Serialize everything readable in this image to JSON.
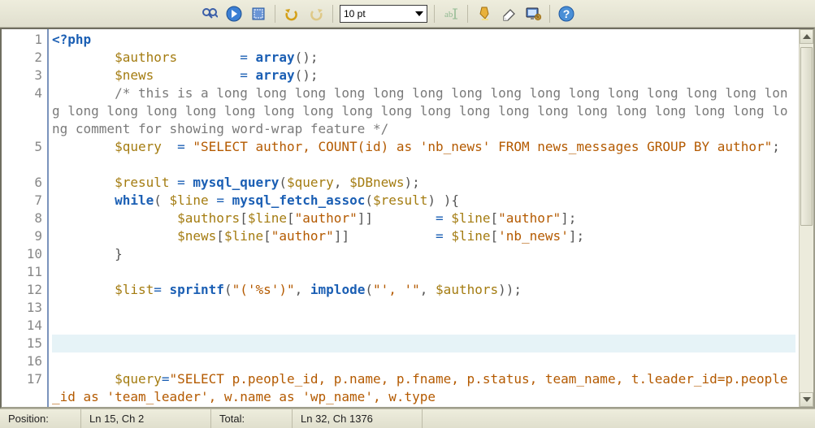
{
  "toolbar": {
    "font_size": "10 pt",
    "icons": {
      "find": "find-icon",
      "go": "go-icon",
      "rect": "rect-icon",
      "undo": "undo-icon",
      "redo": "redo-icon",
      "rename": "rename-icon",
      "highlight": "highlight-icon",
      "erase": "erase-icon",
      "display": "display-icon",
      "help": "help-icon"
    }
  },
  "gutter": {
    "lines": [
      "1",
      "2",
      "3",
      "4",
      "5",
      "6",
      "7",
      "8",
      "9",
      "10",
      "11",
      "12",
      "13",
      "14",
      "15",
      "16",
      "17"
    ],
    "heights": [
      1,
      1,
      1,
      3,
      2,
      1,
      1,
      1,
      1,
      1,
      1,
      1,
      1,
      1,
      1,
      1,
      2
    ]
  },
  "code": {
    "lines": [
      {
        "h": 1,
        "parts": [
          [
            "kw",
            "<?php"
          ]
        ]
      },
      {
        "h": 1,
        "parts": [
          [
            "plain",
            "        "
          ],
          [
            "var",
            "$authors"
          ],
          [
            "plain",
            "        "
          ],
          [
            "op",
            "= "
          ],
          [
            "fn",
            "array"
          ],
          [
            "plain",
            "();"
          ]
        ]
      },
      {
        "h": 1,
        "parts": [
          [
            "plain",
            "        "
          ],
          [
            "var",
            "$news"
          ],
          [
            "plain",
            "           "
          ],
          [
            "op",
            "= "
          ],
          [
            "fn",
            "array"
          ],
          [
            "plain",
            "();"
          ]
        ]
      },
      {
        "h": 3,
        "parts": [
          [
            "plain",
            "        "
          ],
          [
            "cmt",
            "/* this is a long long long long long long long long long long long long long long long long long long long long long long long long long long long long long long long long long long comment for showing word-wrap feature */"
          ]
        ]
      },
      {
        "h": 2,
        "parts": [
          [
            "plain",
            "        "
          ],
          [
            "var",
            "$query"
          ],
          [
            "plain",
            "  "
          ],
          [
            "op",
            "= "
          ],
          [
            "str",
            "\"SELECT author, COUNT(id) as 'nb_news' FROM news_messages GROUP BY author\""
          ],
          [
            "plain",
            ";"
          ]
        ]
      },
      {
        "h": 1,
        "parts": [
          [
            "plain",
            "        "
          ],
          [
            "var",
            "$result"
          ],
          [
            "plain",
            " "
          ],
          [
            "op",
            "= "
          ],
          [
            "fn",
            "mysql_query"
          ],
          [
            "plain",
            "("
          ],
          [
            "var",
            "$query"
          ],
          [
            "plain",
            ", "
          ],
          [
            "var",
            "$DBnews"
          ],
          [
            "plain",
            ");"
          ]
        ]
      },
      {
        "h": 1,
        "parts": [
          [
            "plain",
            "        "
          ],
          [
            "kw",
            "while"
          ],
          [
            "plain",
            "( "
          ],
          [
            "var",
            "$line"
          ],
          [
            "plain",
            " "
          ],
          [
            "op",
            "= "
          ],
          [
            "fn",
            "mysql_fetch_assoc"
          ],
          [
            "plain",
            "("
          ],
          [
            "var",
            "$result"
          ],
          [
            "plain",
            ") ){"
          ]
        ]
      },
      {
        "h": 1,
        "parts": [
          [
            "plain",
            "                "
          ],
          [
            "var",
            "$authors"
          ],
          [
            "plain",
            "["
          ],
          [
            "var",
            "$line"
          ],
          [
            "plain",
            "["
          ],
          [
            "str",
            "\"author\""
          ],
          [
            "plain",
            "]]        "
          ],
          [
            "op",
            "= "
          ],
          [
            "var",
            "$line"
          ],
          [
            "plain",
            "["
          ],
          [
            "str",
            "\"author\""
          ],
          [
            "plain",
            "];"
          ]
        ]
      },
      {
        "h": 1,
        "parts": [
          [
            "plain",
            "                "
          ],
          [
            "var",
            "$news"
          ],
          [
            "plain",
            "["
          ],
          [
            "var",
            "$line"
          ],
          [
            "plain",
            "["
          ],
          [
            "str",
            "\"author\""
          ],
          [
            "plain",
            "]]           "
          ],
          [
            "op",
            "= "
          ],
          [
            "var",
            "$line"
          ],
          [
            "plain",
            "["
          ],
          [
            "str",
            "'nb_news'"
          ],
          [
            "plain",
            "];"
          ]
        ]
      },
      {
        "h": 1,
        "parts": [
          [
            "plain",
            "        }"
          ]
        ]
      },
      {
        "h": 1,
        "parts": []
      },
      {
        "h": 1,
        "parts": [
          [
            "plain",
            "        "
          ],
          [
            "var",
            "$list"
          ],
          [
            "op",
            "= "
          ],
          [
            "fn",
            "sprintf"
          ],
          [
            "plain",
            "("
          ],
          [
            "str",
            "\"('%s')\""
          ],
          [
            "plain",
            ", "
          ],
          [
            "fn",
            "implode"
          ],
          [
            "plain",
            "("
          ],
          [
            "str",
            "\"', '\""
          ],
          [
            "plain",
            ", "
          ],
          [
            "var",
            "$authors"
          ],
          [
            "plain",
            "));"
          ]
        ]
      },
      {
        "h": 1,
        "parts": []
      },
      {
        "h": 1,
        "parts": []
      },
      {
        "h": 1,
        "current": true,
        "parts": [
          [
            "plain",
            "        "
          ]
        ]
      },
      {
        "h": 1,
        "parts": []
      },
      {
        "h": 2,
        "parts": [
          [
            "plain",
            "        "
          ],
          [
            "var",
            "$query"
          ],
          [
            "op",
            "="
          ],
          [
            "str",
            "\"SELECT p.people_id, p.name, p.fname, p.status, team_name, t.leader_id=p.people_id as 'team_leader', w.name as 'wp_name', w.type"
          ]
        ]
      }
    ]
  },
  "status": {
    "pos_label": "Position:",
    "pos_value": "Ln 15, Ch 2",
    "total_label": "Total:",
    "total_value": "Ln 32, Ch 1376"
  }
}
